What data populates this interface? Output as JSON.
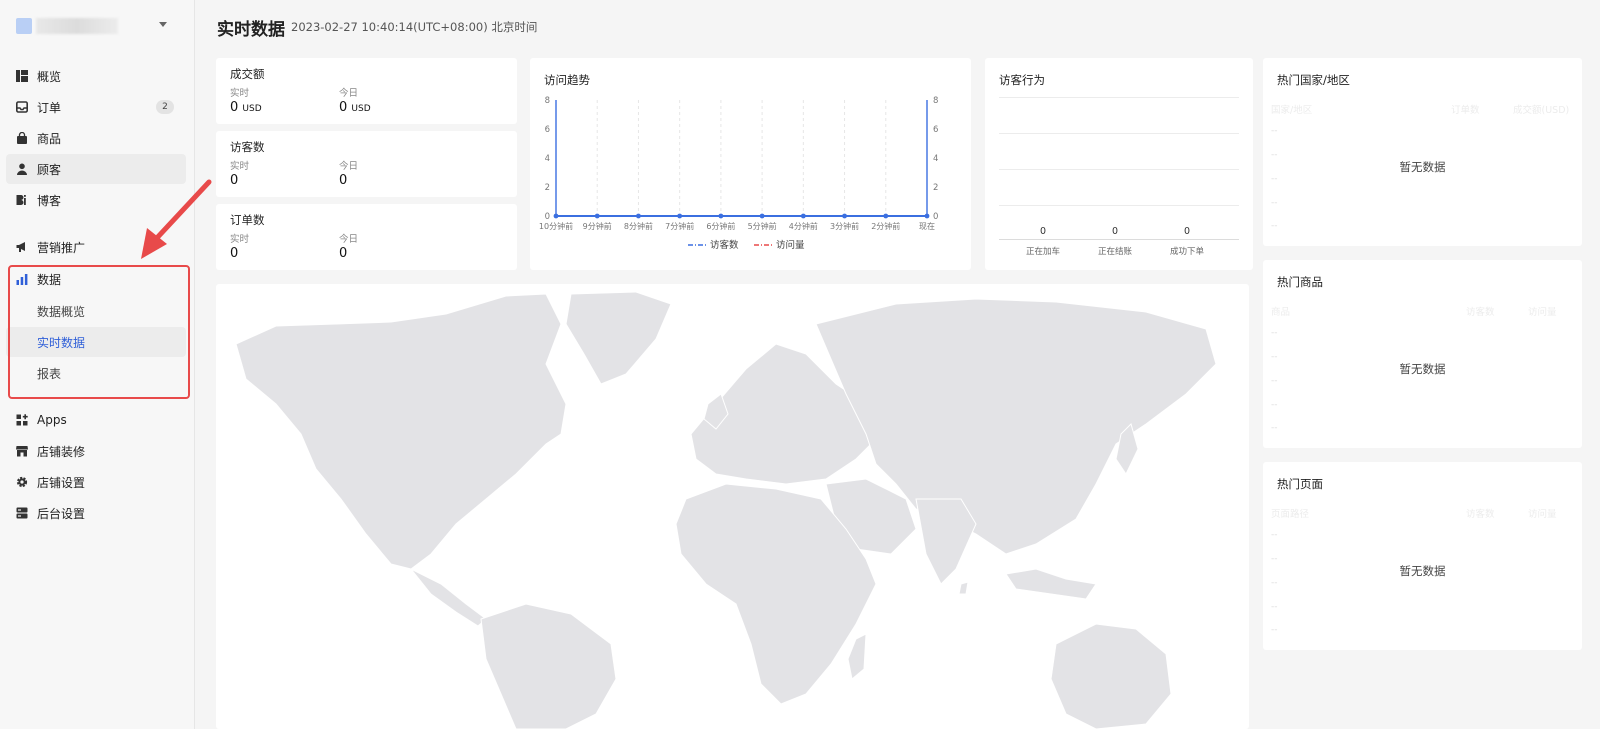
{
  "sidebar": {
    "items": [
      {
        "label": "概览",
        "icon": "dashboard-icon"
      },
      {
        "label": "订单",
        "icon": "inbox-icon",
        "badge": "2"
      },
      {
        "label": "商品",
        "icon": "shopping-bag-icon"
      },
      {
        "label": "顾客",
        "icon": "person-icon"
      },
      {
        "label": "博客",
        "icon": "blog-icon"
      },
      {
        "label": "营销推广",
        "icon": "megaphone-icon"
      },
      {
        "label": "数据",
        "icon": "bar-chart-icon"
      },
      {
        "label": "Apps",
        "icon": "apps-icon"
      },
      {
        "label": "店铺装修",
        "icon": "storefront-icon"
      },
      {
        "label": "店铺设置",
        "icon": "gear-icon"
      },
      {
        "label": "后台设置",
        "icon": "server-icon"
      }
    ],
    "data_sub_items": [
      {
        "label": "数据概览"
      },
      {
        "label": "实时数据"
      },
      {
        "label": "报表"
      }
    ],
    "accent_color": "#2f5fd8"
  },
  "header": {
    "title": "实时数据",
    "subtitle": "2023-02-27 10:40:14(UTC+08:00) 北京时间"
  },
  "stats": {
    "realtime_label": "实时",
    "today_label": "今日",
    "sales": {
      "title": "成交额",
      "realtime": "0",
      "today": "0",
      "unit": "USD"
    },
    "visitors": {
      "title": "访客数",
      "realtime": "0",
      "today": "0"
    },
    "orders": {
      "title": "订单数",
      "realtime": "0",
      "today": "0"
    }
  },
  "trend": {
    "title": "访问趋势",
    "legend": [
      "访客数",
      "访问量"
    ],
    "legend_colors": [
      "#3b6fe0",
      "#e84a4a"
    ]
  },
  "chart_data": {
    "type": "line",
    "title": "访问趋势",
    "x": [
      "10分钟前",
      "9分钟前",
      "8分钟前",
      "7分钟前",
      "6分钟前",
      "5分钟前",
      "4分钟前",
      "3分钟前",
      "2分钟前",
      "现在"
    ],
    "ylim": [
      0,
      8
    ],
    "yticks": [
      0,
      2,
      4,
      6,
      8
    ],
    "series": [
      {
        "name": "访客数",
        "values": [
          0,
          0,
          0,
          0,
          0,
          0,
          0,
          0,
          0,
          0
        ]
      },
      {
        "name": "访问量",
        "values": [
          0,
          0,
          0,
          0,
          0,
          0,
          0,
          0,
          0,
          0
        ]
      }
    ]
  },
  "behavior": {
    "title": "访客行为",
    "stages": [
      {
        "label": "正在加车",
        "value": "0"
      },
      {
        "label": "正在结账",
        "value": "0"
      },
      {
        "label": "成功下单",
        "value": "0"
      }
    ]
  },
  "hot_regions": {
    "title": "热门国家/地区",
    "columns": [
      "国家/地区",
      "订单数",
      "成交额(USD)"
    ],
    "empty_text": "暂无数据"
  },
  "hot_products": {
    "title": "热门商品",
    "columns": [
      "商品",
      "访客数",
      "访问量"
    ],
    "empty_text": "暂无数据"
  },
  "hot_pages": {
    "title": "热门页面",
    "columns": [
      "页面路径",
      "访客数",
      "访问量"
    ],
    "empty_text": "暂无数据"
  },
  "placeholder_dash": "--"
}
